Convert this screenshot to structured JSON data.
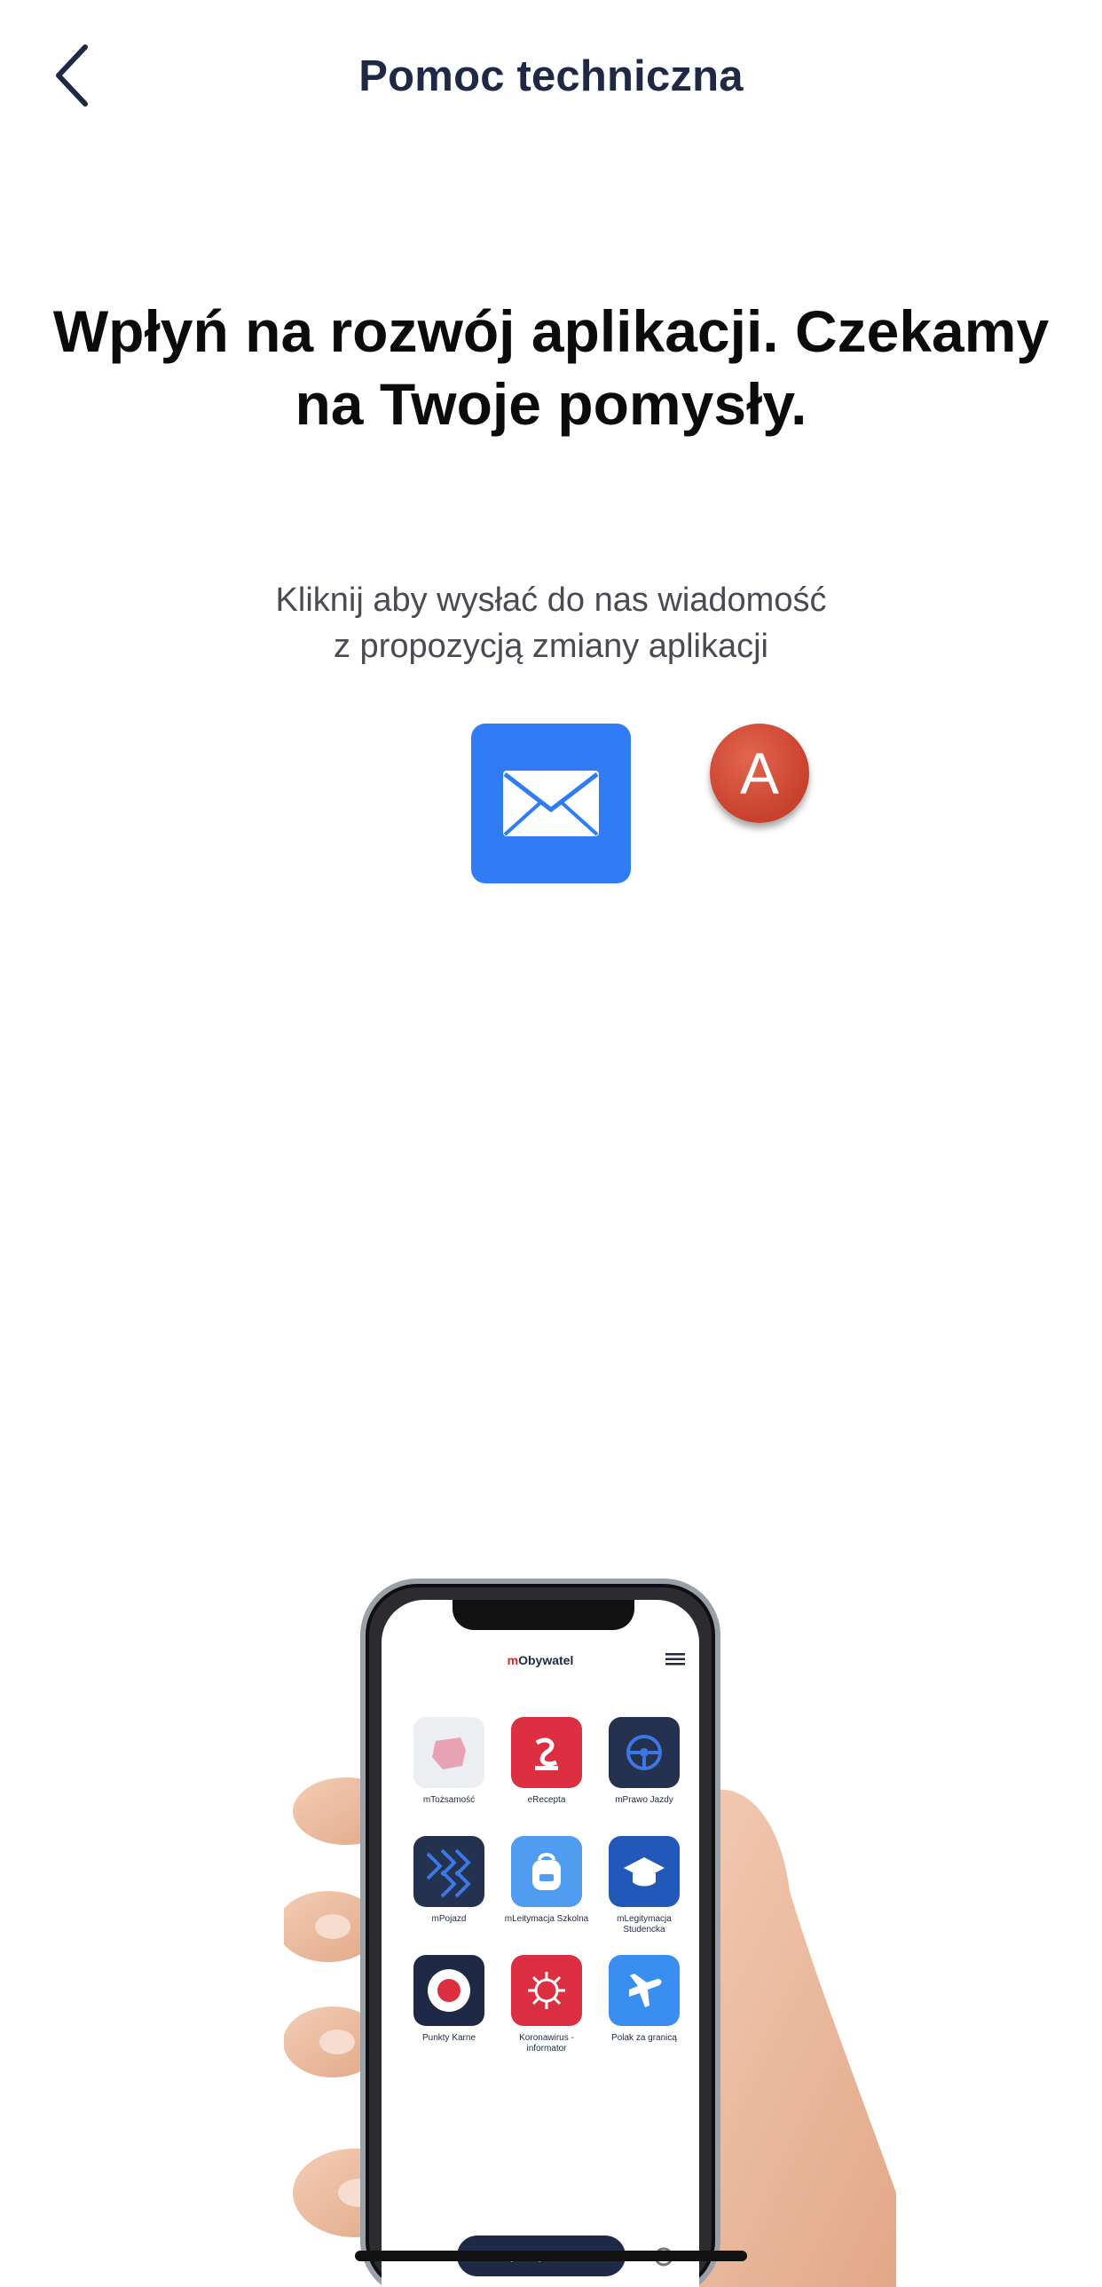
{
  "header": {
    "title": "Pomoc techniczna",
    "back_icon": "chevron-left-icon"
  },
  "main": {
    "headline": "Wpłyń na rozwój aplikacji. Czekamy na Twoje pomysły.",
    "subtext_line1": "Kliknij aby wysłać do nas wiadomość",
    "subtext_line2": "z propozycją zmiany aplikacji",
    "mail_icon": "envelope-icon",
    "avatar_letter": "A"
  },
  "illustration": {
    "app_name_prefix": "m",
    "app_name_rest": "Obywatel",
    "tiles": [
      {
        "label": "mTożsamość"
      },
      {
        "label": "eRecepta"
      },
      {
        "label": "mPrawo Jazdy"
      },
      {
        "label": "mPojazd"
      },
      {
        "label": "mLeitymacja Szkolna"
      },
      {
        "label": "mLegitymacja Studencka"
      },
      {
        "label": "Punkty Karne"
      },
      {
        "label": "Koronawirus - informator"
      },
      {
        "label": "Polak za granicą"
      }
    ],
    "add_button": "Dodaj nowy dokument"
  },
  "colors": {
    "accent": "#2f7cf6",
    "avatar": "#c8412d",
    "title_text": "#1f2946"
  }
}
